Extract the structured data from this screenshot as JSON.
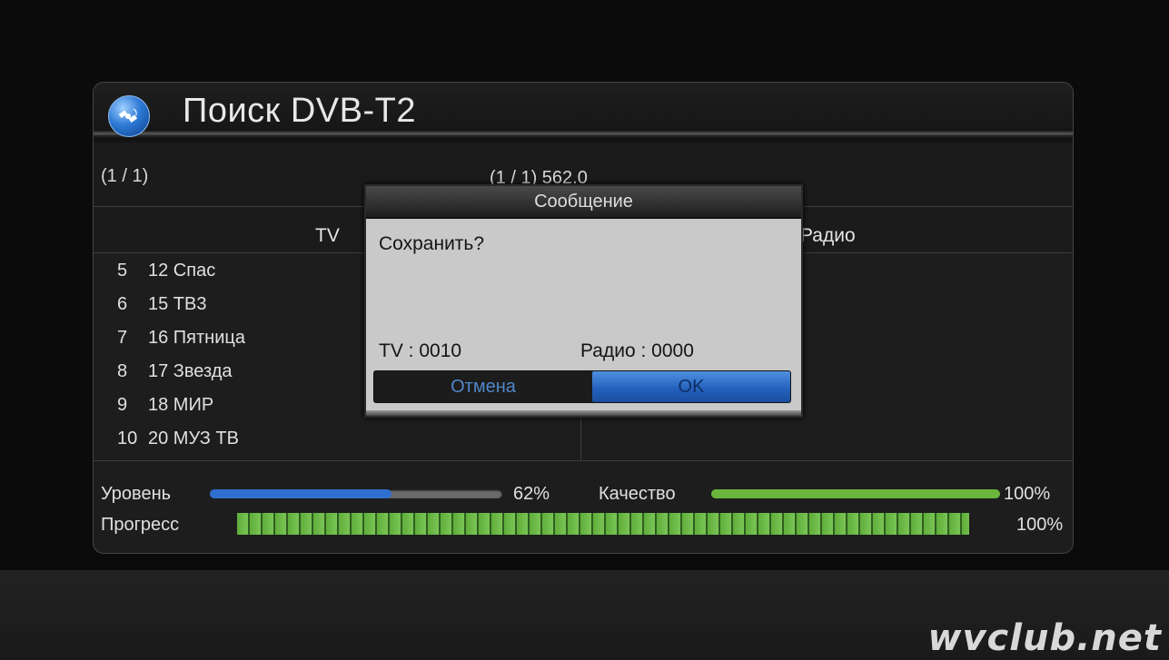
{
  "header": {
    "title": "Поиск DVB-T2",
    "icon": "satellite-icon"
  },
  "info": {
    "left_page": "(1 / 1)",
    "center": "(1 / 1) 562.0"
  },
  "columns": {
    "tv": "TV",
    "radio": "Радио"
  },
  "channels": [
    {
      "num": "5",
      "name": "12 Спас"
    },
    {
      "num": "6",
      "name": "15 ТВ3"
    },
    {
      "num": "7",
      "name": "16 Пятница"
    },
    {
      "num": "8",
      "name": "17 Звезда"
    },
    {
      "num": "9",
      "name": "18 МИР"
    },
    {
      "num": "10",
      "name": "20 МУЗ ТВ"
    }
  ],
  "signal": {
    "level_label": "Уровень",
    "level_value": "62%",
    "level_fraction": 0.62,
    "quality_label": "Качество",
    "quality_value": "100%",
    "quality_fraction": 1.0,
    "progress_label": "Прогресс",
    "progress_value": "100%",
    "progress_fraction": 1.0
  },
  "dialog": {
    "title": "Сообщение",
    "message": "Сохранить?",
    "tv_count": "TV  :  0010",
    "radio_count": "Радио  :  0000",
    "cancel_label": "Отмена",
    "ok_label": "OK"
  },
  "watermark": "wvclub.net",
  "colors": {
    "level_bar": "#2f6fd0",
    "quality_bar": "#6ab53c",
    "ok_button": "#2e6cc8"
  }
}
